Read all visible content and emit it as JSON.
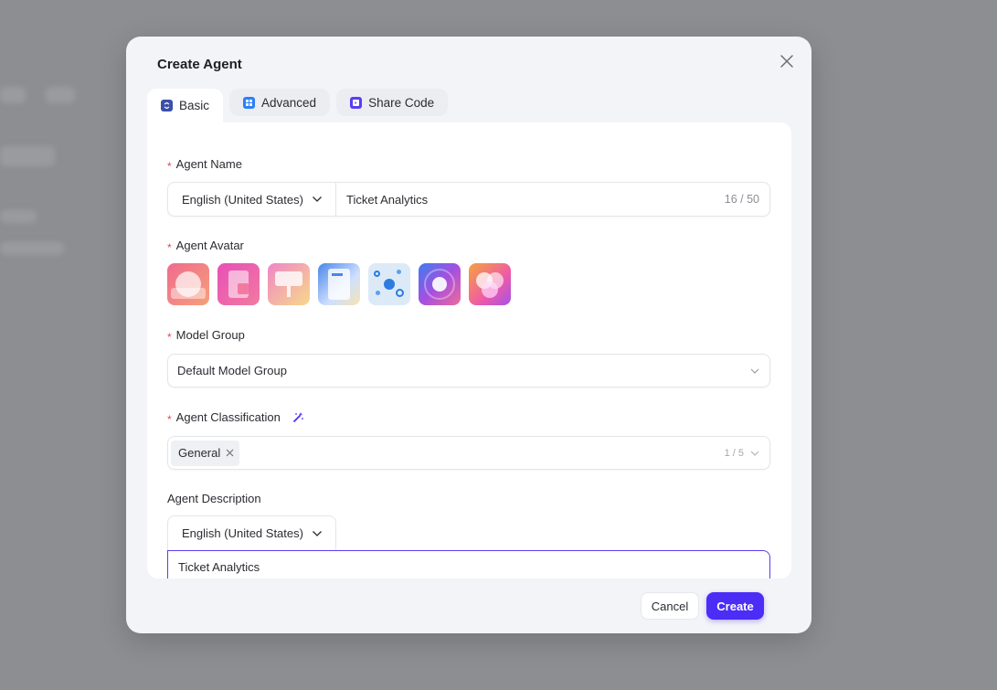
{
  "dialog": {
    "title": "Create Agent",
    "tabs": [
      {
        "label": "Basic",
        "icon": "basic-icon",
        "active": true
      },
      {
        "label": "Advanced",
        "icon": "grid-icon",
        "active": false
      },
      {
        "label": "Share Code",
        "icon": "code-icon",
        "active": false
      }
    ]
  },
  "form": {
    "agent_name": {
      "label": "Agent Name",
      "required_mark": "*",
      "language": "English (United States)",
      "value": "Ticket Analytics",
      "counter": "16 / 50"
    },
    "agent_avatar": {
      "label": "Agent Avatar",
      "required_mark": "*"
    },
    "model_group": {
      "label": "Model Group",
      "required_mark": "*",
      "value": "Default Model Group"
    },
    "agent_classification": {
      "label": "Agent Classification",
      "required_mark": "*",
      "tag": "General",
      "counter": "1 / 5"
    },
    "agent_description": {
      "label": "Agent Description",
      "language": "English (United States)",
      "value": "Ticket Analytics"
    }
  },
  "footer": {
    "cancel_label": "Cancel",
    "create_label": "Create"
  },
  "colors": {
    "accent": "#4a2ef5",
    "required": "#e5484d"
  }
}
